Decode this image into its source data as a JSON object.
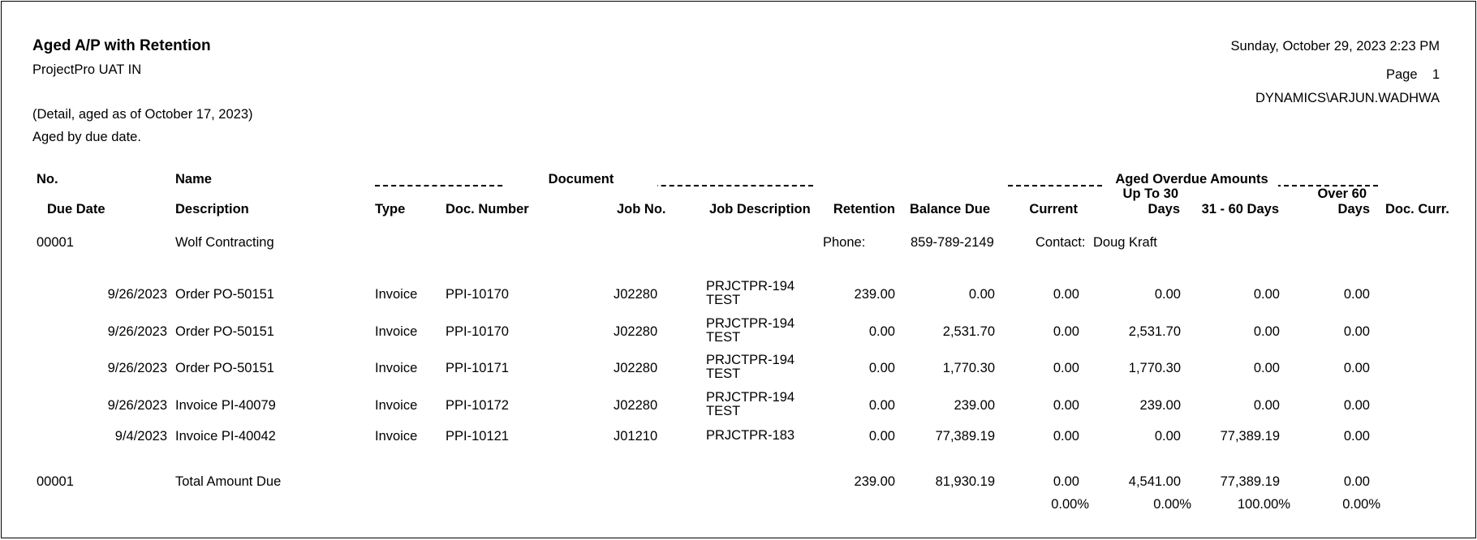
{
  "report": {
    "title": "Aged A/P with Retention",
    "company": "ProjectPro UAT IN",
    "detail_line": "(Detail, aged as of October 17, 2023)",
    "aged_by": "Aged by  due date.",
    "datetime": "Sunday, October 29, 2023 2:23 PM",
    "page_label": "Page",
    "page_number": "1",
    "user": "DYNAMICS\\ARJUN.WADHWA"
  },
  "headers": {
    "no": "No.",
    "name": "Name",
    "document_group": "Document",
    "aged_group": "Aged Overdue Amounts",
    "due_date": "Due Date",
    "description": "Description",
    "type": "Type",
    "doc_number": "Doc. Number",
    "job_no": "Job No.",
    "job_description": "Job Description",
    "retention": "Retention",
    "balance_due": "Balance Due",
    "current": "Current",
    "up_to_30_l1": "Up To 30",
    "up_to_30_l2": "Days",
    "d31_60": "31 - 60 Days",
    "over_60_l1": "Over 60",
    "over_60_l2": "Days",
    "doc_curr": "Doc. Curr."
  },
  "vendor": {
    "no": "00001",
    "name": "Wolf Contracting",
    "phone_label": "Phone:",
    "phone": "859-789-2149",
    "contact_label": "Contact:",
    "contact": "Doug Kraft"
  },
  "rows": [
    {
      "due_date": "9/26/2023",
      "description": "Order PO-50151",
      "type": "Invoice",
      "doc_number": "PPI-10170",
      "job_no": "J02280",
      "job_description": "PRJCTPR-194 TEST",
      "retention": "239.00",
      "balance_due": "0.00",
      "current": "0.00",
      "up_to_30": "0.00",
      "d31_60": "0.00",
      "over_60": "0.00"
    },
    {
      "due_date": "9/26/2023",
      "description": "Order PO-50151",
      "type": "Invoice",
      "doc_number": "PPI-10170",
      "job_no": "J02280",
      "job_description": "PRJCTPR-194 TEST",
      "retention": "0.00",
      "balance_due": "2,531.70",
      "current": "0.00",
      "up_to_30": "2,531.70",
      "d31_60": "0.00",
      "over_60": "0.00"
    },
    {
      "due_date": "9/26/2023",
      "description": "Order PO-50151",
      "type": "Invoice",
      "doc_number": "PPI-10171",
      "job_no": "J02280",
      "job_description": "PRJCTPR-194 TEST",
      "retention": "0.00",
      "balance_due": "1,770.30",
      "current": "0.00",
      "up_to_30": "1,770.30",
      "d31_60": "0.00",
      "over_60": "0.00"
    },
    {
      "due_date": "9/26/2023",
      "description": "Invoice PI-40079",
      "type": "Invoice",
      "doc_number": "PPI-10172",
      "job_no": "J02280",
      "job_description": "PRJCTPR-194 TEST",
      "retention": "0.00",
      "balance_due": "239.00",
      "current": "0.00",
      "up_to_30": "239.00",
      "d31_60": "0.00",
      "over_60": "0.00"
    },
    {
      "due_date": "9/4/2023",
      "description": "Invoice PI-40042",
      "type": "Invoice",
      "doc_number": "PPI-10121",
      "job_no": "J01210",
      "job_description": "PRJCTPR-183",
      "retention": "0.00",
      "balance_due": "77,389.19",
      "current": "0.00",
      "up_to_30": "0.00",
      "d31_60": "77,389.19",
      "over_60": "0.00"
    }
  ],
  "total": {
    "no": "00001",
    "label": "Total Amount Due",
    "retention": "239.00",
    "balance_due": "81,930.19",
    "current": "0.00",
    "up_to_30": "4,541.00",
    "d31_60": "77,389.19",
    "over_60": "0.00",
    "pct_current": "0.00%",
    "pct_up_to_30": "0.00%",
    "pct_31_60": "100.00%",
    "pct_over_60": "0.00%"
  }
}
